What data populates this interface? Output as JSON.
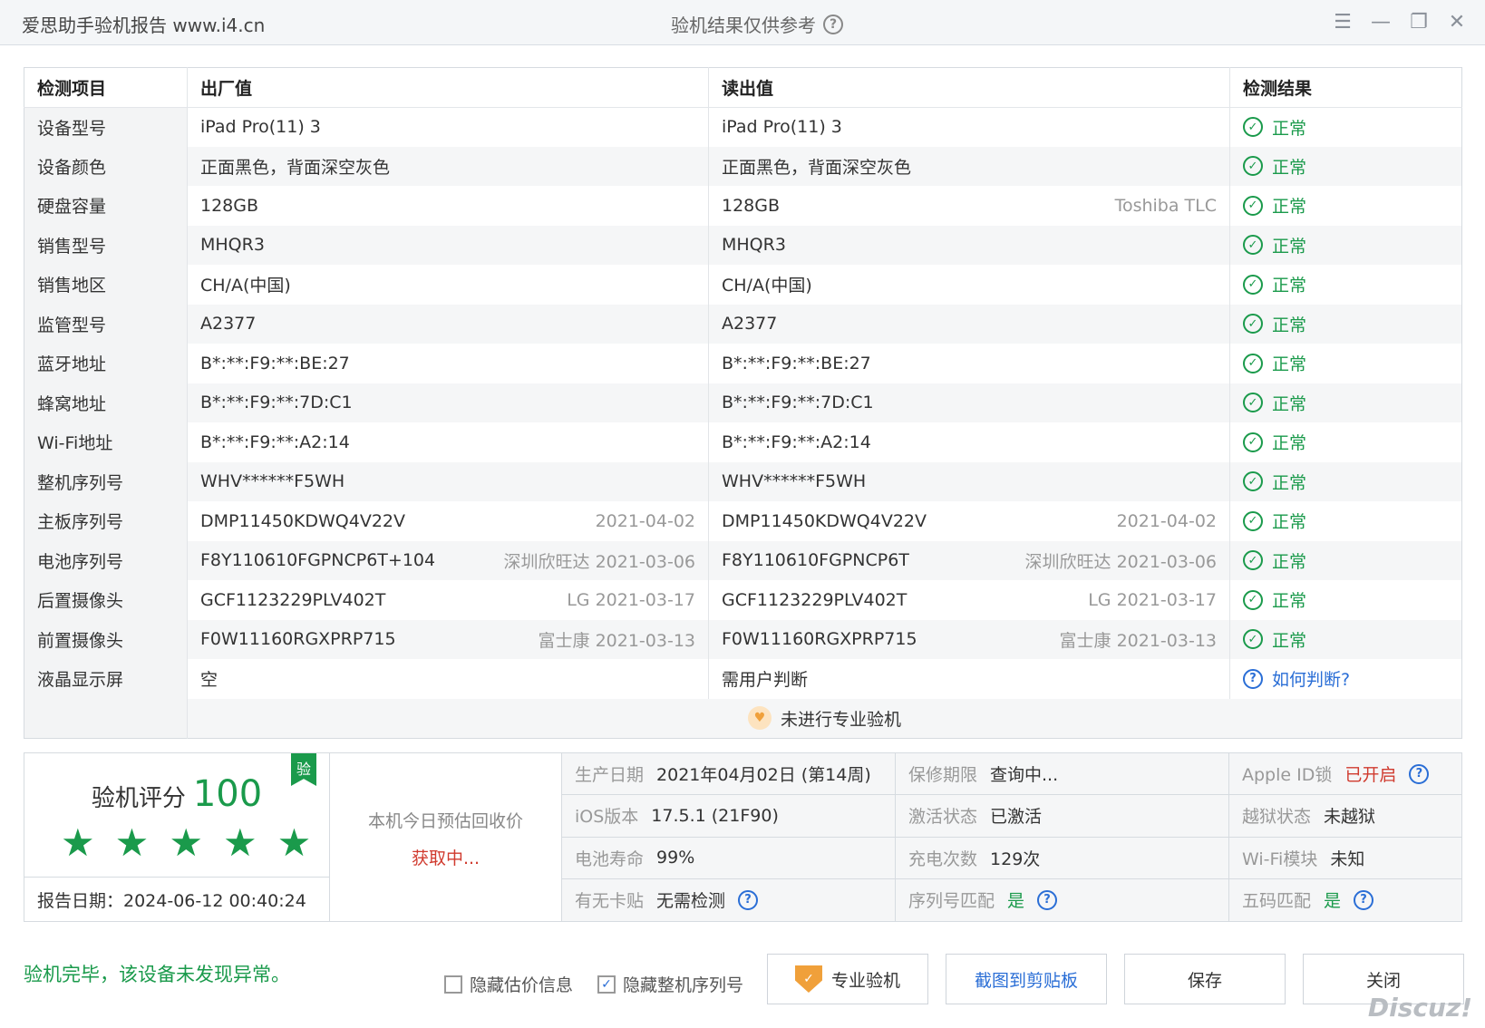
{
  "titlebar": {
    "app_title": "爱思助手验机报告 www.i4.cn",
    "center_title": "验机结果仅供参考",
    "help_icon": "question-circle-icon"
  },
  "table": {
    "headers": [
      "检测项目",
      "出厂值",
      "读出值",
      "检测结果"
    ],
    "rows": [
      {
        "label": "设备型号",
        "factory": "iPad Pro(11) 3",
        "factory_sub": "",
        "read": "iPad Pro(11) 3",
        "read_sub": "",
        "result": "正常"
      },
      {
        "label": "设备颜色",
        "factory": "正面黑色，背面深空灰色",
        "factory_sub": "",
        "read": "正面黑色，背面深空灰色",
        "read_sub": "",
        "result": "正常"
      },
      {
        "label": "硬盘容量",
        "factory": "128GB",
        "factory_sub": "",
        "read": "128GB",
        "read_sub": "Toshiba TLC",
        "result": "正常"
      },
      {
        "label": "销售型号",
        "factory": "MHQR3",
        "factory_sub": "",
        "read": "MHQR3",
        "read_sub": "",
        "result": "正常"
      },
      {
        "label": "销售地区",
        "factory": "CH/A(中国)",
        "factory_sub": "",
        "read": "CH/A(中国)",
        "read_sub": "",
        "result": "正常"
      },
      {
        "label": "监管型号",
        "factory": "A2377",
        "factory_sub": "",
        "read": "A2377",
        "read_sub": "",
        "result": "正常"
      },
      {
        "label": "蓝牙地址",
        "factory": "B*:**:F9:**:BE:27",
        "factory_sub": "",
        "read": "B*:**:F9:**:BE:27",
        "read_sub": "",
        "result": "正常"
      },
      {
        "label": "蜂窝地址",
        "factory": "B*:**:F9:**:7D:C1",
        "factory_sub": "",
        "read": "B*:**:F9:**:7D:C1",
        "read_sub": "",
        "result": "正常"
      },
      {
        "label": "Wi-Fi地址",
        "factory": "B*:**:F9:**:A2:14",
        "factory_sub": "",
        "read": "B*:**:F9:**:A2:14",
        "read_sub": "",
        "result": "正常"
      },
      {
        "label": "整机序列号",
        "factory": "WHV******F5WH",
        "factory_sub": "",
        "read": "WHV******F5WH",
        "read_sub": "",
        "result": "正常"
      },
      {
        "label": "主板序列号",
        "factory": "DMP11450KDWQ4V22V",
        "factory_sub": "2021-04-02",
        "read": "DMP11450KDWQ4V22V",
        "read_sub": "2021-04-02",
        "result": "正常"
      },
      {
        "label": "电池序列号",
        "factory": "F8Y110610FGPNCP6T+104",
        "factory_sub": "深圳欣旺达 2021-03-06",
        "read": "F8Y110610FGPNCP6T",
        "read_sub": "深圳欣旺达 2021-03-06",
        "result": "正常"
      },
      {
        "label": "后置摄像头",
        "factory": "GCF1123229PLV402T",
        "factory_sub": "LG 2021-03-17",
        "read": "GCF1123229PLV402T",
        "read_sub": "LG 2021-03-17",
        "result": "正常"
      },
      {
        "label": "前置摄像头",
        "factory": "F0W11160RGXPRP715",
        "factory_sub": "富士康 2021-03-13",
        "read": "F0W11160RGXPRP715",
        "read_sub": "富士康 2021-03-13",
        "result": "正常"
      }
    ],
    "lcd_row": {
      "label": "液晶显示屏",
      "factory": "空",
      "read": "需用户判断",
      "link": "如何判断?"
    },
    "notice": "未进行专业验机"
  },
  "summary": {
    "score_label": "验机评分",
    "score": "100",
    "badge": "验",
    "stars_filled": 5,
    "report_date": "报告日期：2024-06-12 00:40:24",
    "recycle_label": "本机今日预估回收价",
    "recycle_value": "获取中...",
    "info": [
      {
        "label": "生产日期",
        "value": "2021年04月02日 (第14周)",
        "style": "",
        "help": false
      },
      {
        "label": "保修期限",
        "value": "查询中...",
        "style": "",
        "help": false
      },
      {
        "label": "Apple ID锁",
        "value": "已开启",
        "style": "red",
        "help": true
      },
      {
        "label": "iOS版本",
        "value": "17.5.1 (21F90)",
        "style": "",
        "help": false
      },
      {
        "label": "激活状态",
        "value": "已激活",
        "style": "",
        "help": false
      },
      {
        "label": "越狱状态",
        "value": "未越狱",
        "style": "",
        "help": false
      },
      {
        "label": "电池寿命",
        "value": "99%",
        "style": "",
        "help": false
      },
      {
        "label": "充电次数",
        "value": "129次",
        "style": "",
        "help": false
      },
      {
        "label": "Wi-Fi模块",
        "value": "未知",
        "style": "",
        "help": false
      },
      {
        "label": "有无卡贴",
        "value": "无需检测",
        "style": "",
        "help": true
      },
      {
        "label": "序列号匹配",
        "value": "是",
        "style": "green",
        "help": true
      },
      {
        "label": "五码匹配",
        "value": "是",
        "style": "green",
        "help": true
      }
    ]
  },
  "footer": {
    "message": "验机完毕，该设备未发现异常。",
    "hide_price_label": "隐藏估价信息",
    "hide_price_checked": false,
    "hide_serial_label": "隐藏整机序列号",
    "hide_serial_checked": true,
    "pro_button": "专业验机",
    "copy_button": "截图到剪贴板",
    "save_button": "保存",
    "close_button": "关闭",
    "watermark": "Discuz!"
  },
  "colors": {
    "accent_green": "#1a9a4b",
    "link_blue": "#2a6ed6",
    "alert_red": "#d03a2e"
  }
}
